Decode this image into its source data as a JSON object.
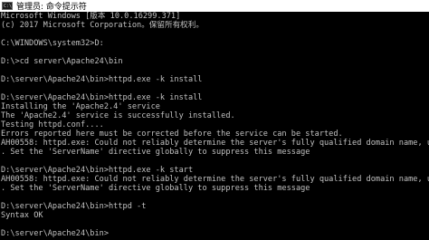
{
  "window": {
    "title": "管理员: 命令提示符",
    "icon_name": "console-icon",
    "icon_glyph": "C:\\"
  },
  "console": {
    "lines": [
      "Microsoft Windows [版本 10.0.16299.371]",
      "(c) 2017 Microsoft Corporation。保留所有权利。",
      "",
      "C:\\WINDOWS\\system32>D:",
      "",
      "D:\\>cd server\\Apache24\\bin",
      "",
      "D:\\server\\Apache24\\bin>httpd.exe -k install",
      "",
      "D:\\server\\Apache24\\bin>httpd.exe -k install",
      "Installing the 'Apache2.4' service",
      "The 'Apache2.4' service is successfully installed.",
      "Testing httpd.conf....",
      "Errors reported here must be corrected before the service can be started.",
      "AH00558: httpd.exe: Could not reliably determine the server's fully qualified domain name, using",
      ". Set the 'ServerName' directive globally to suppress this message",
      "",
      "D:\\server\\Apache24\\bin>httpd.exe -k start",
      "AH00558: httpd.exe: Could not reliably determine the server's fully qualified domain name, using",
      ". Set the 'ServerName' directive globally to suppress this message",
      "",
      "D:\\server\\Apache24\\bin>httpd -t",
      "Syntax OK",
      "",
      "D:\\server\\Apache24\\bin>"
    ]
  },
  "colors": {
    "background": "#000000",
    "text": "#c0c0c0",
    "titlebar": "#ffffff"
  }
}
